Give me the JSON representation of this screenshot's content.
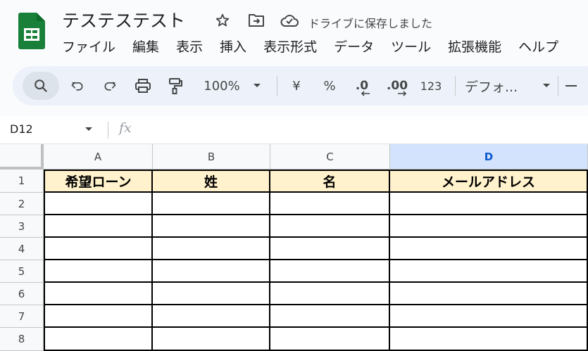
{
  "document": {
    "title": "テステステスト",
    "save_status": "ドライブに保存しました"
  },
  "menu": [
    "ファイル",
    "編集",
    "表示",
    "挿入",
    "表示形式",
    "データ",
    "ツール",
    "拡張機能",
    "ヘルプ"
  ],
  "toolbar": {
    "zoom": "100%",
    "currency": "¥",
    "percent": "%",
    "decrease_decimal": ".0",
    "increase_decimal": ".00",
    "number_format": "123",
    "font": "デフォ..."
  },
  "formula_bar": {
    "cell_ref": "D12",
    "fx": "fx"
  },
  "grid": {
    "columns": [
      "A",
      "B",
      "C",
      "D"
    ],
    "selected_column": "D",
    "rows": [
      "1",
      "2",
      "3",
      "4",
      "5",
      "6",
      "7",
      "8"
    ],
    "header_row": [
      "希望ローン",
      "姓",
      "名",
      "メールアドレス"
    ],
    "header_fill": "#fff2cc"
  },
  "colors": {
    "sheets_green": "#188038",
    "selected_header": "#d3e3fd"
  }
}
